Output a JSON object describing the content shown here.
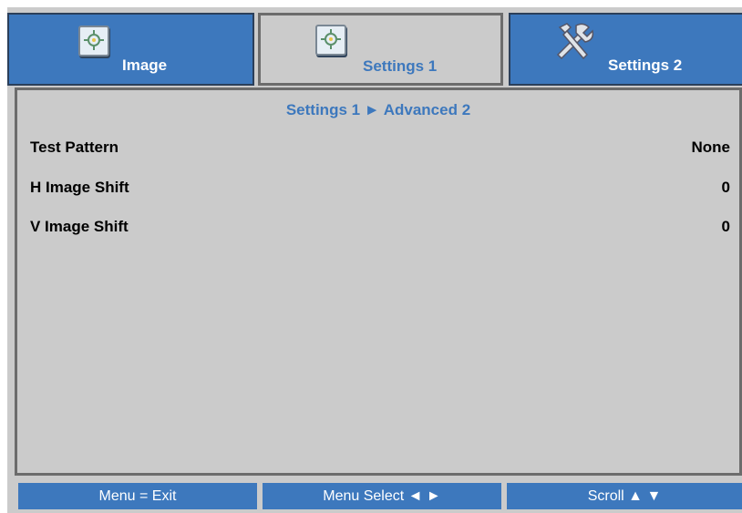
{
  "tabs": [
    {
      "label": "Image",
      "icon": "image-icon"
    },
    {
      "label": "Settings 1",
      "icon": "settings1-icon"
    },
    {
      "label": "Settings 2",
      "icon": "tools-icon"
    }
  ],
  "colors": {
    "accent": "#3d78bd",
    "panel_bg": "#cbcbcb",
    "border": "#6c6c6c"
  },
  "breadcrumb": "Settings 1 ► Advanced 2",
  "menu_items": [
    {
      "label": "Test Pattern",
      "value": "None"
    },
    {
      "label": "H Image Shift",
      "value": "0"
    },
    {
      "label": "V Image Shift",
      "value": "0"
    }
  ],
  "footer": {
    "exit": "Menu = Exit",
    "select": "Menu Select ◄ ►",
    "scroll": "Scroll ▲ ▼"
  }
}
